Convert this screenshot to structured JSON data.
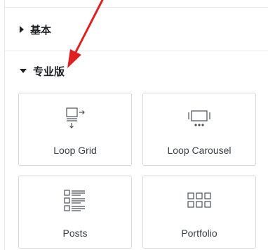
{
  "sections": [
    {
      "title": "基本",
      "expanded": false
    },
    {
      "title": "专业版",
      "expanded": true
    }
  ],
  "widgets": [
    {
      "label": "Loop Grid",
      "icon": "loop-grid-icon"
    },
    {
      "label": "Loop Carousel",
      "icon": "loop-carousel-icon"
    },
    {
      "label": "Posts",
      "icon": "posts-icon"
    },
    {
      "label": "Portfolio",
      "icon": "portfolio-icon"
    }
  ],
  "annotation": {
    "color": "#e02020",
    "icon": "red-arrow-icon"
  }
}
